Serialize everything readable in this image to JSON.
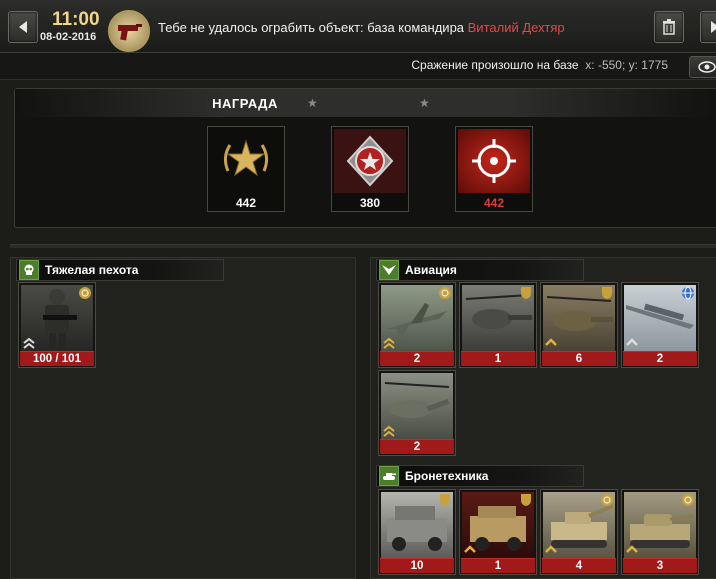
{
  "header": {
    "time": "11:00",
    "date": "08-02-2016",
    "message": "Тебе не удалось ограбить объект: база командира ",
    "commander": "Виталий Дехтяр"
  },
  "battle": {
    "text": "Сражение произошло на базе",
    "coords": "x: -550; y: 1775"
  },
  "reward": {
    "title": "НАГРАДА",
    "items": [
      {
        "icon": "gold-star-laurel-icon",
        "value": "442"
      },
      {
        "icon": "red-medal-icon",
        "value": "380"
      },
      {
        "icon": "target-crosshair-icon",
        "value": "442"
      }
    ]
  },
  "sections": {
    "infantry": {
      "title": "Тяжелая пехота",
      "icon": "skull-icon",
      "units": [
        {
          "count": "100 / 101",
          "type": "soldier"
        }
      ]
    },
    "aviation": {
      "title": "Авиация",
      "icon": "wings-icon",
      "units": [
        {
          "count": "2",
          "type": "jet"
        },
        {
          "count": "1",
          "type": "helicopter"
        },
        {
          "count": "6",
          "type": "helicopter"
        },
        {
          "count": "2",
          "type": "drone"
        },
        {
          "count": "2",
          "type": "helicopter"
        }
      ]
    },
    "armor": {
      "title": "Бронетехника",
      "icon": "tank-icon",
      "units": [
        {
          "count": "10",
          "type": "humvee"
        },
        {
          "count": "1",
          "type": "humvee"
        },
        {
          "count": "4",
          "type": "artillery"
        },
        {
          "count": "3",
          "type": "tank"
        }
      ]
    }
  },
  "colors": {
    "accent_gold": "#f0d58a",
    "commander_red": "#e24a4a",
    "count_bar_red": "#a11919",
    "section_icon_green": "#4c7d2b"
  }
}
